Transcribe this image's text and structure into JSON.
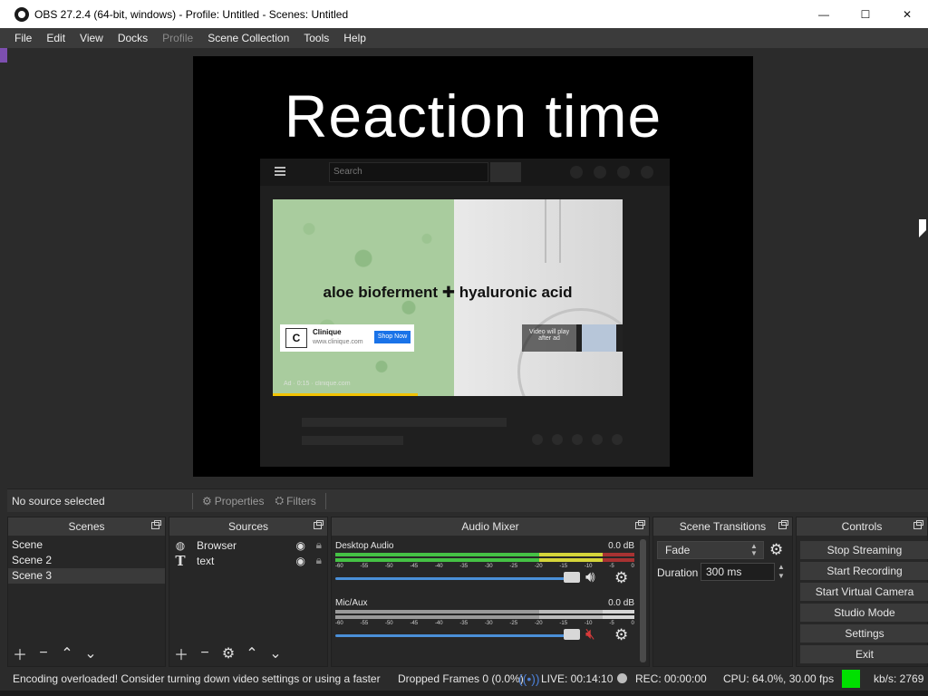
{
  "window": {
    "title": "OBS 27.2.4 (64-bit, windows) - Profile: Untitled - Scenes: Untitled",
    "controls": [
      "—",
      "☐",
      "✕"
    ]
  },
  "menu": {
    "items": [
      "File",
      "Edit",
      "View",
      "Docks",
      "Profile",
      "Scene Collection",
      "Tools",
      "Help"
    ],
    "disabled": [
      "Profile"
    ]
  },
  "preview": {
    "headline": "Reaction time",
    "browser": {
      "search_placeholder": "Search",
      "ad_phrase": "aloe bioferment ✚ hyaluronic acid",
      "ad_brand": "Clinique",
      "ad_brand_logo": "C",
      "ad_url": "www.clinique.com",
      "ad_button": "Shop Now",
      "skip_text": "Video will play after ad",
      "ad_label": "Ad · 0:15 · clinique.com"
    }
  },
  "context": {
    "no_source": "No source selected",
    "properties": "Properties",
    "filters": "Filters"
  },
  "scenes": {
    "title": "Scenes",
    "items": [
      "Scene",
      "Scene 2",
      "Scene 3"
    ],
    "active_index": 2
  },
  "sources": {
    "title": "Sources",
    "items": [
      {
        "name": "Browser",
        "icon": "globe-icon"
      },
      {
        "name": "text",
        "icon": "text-icon"
      }
    ]
  },
  "mixer": {
    "title": "Audio Mixer",
    "scale": [
      "-60",
      "-55",
      "-50",
      "-45",
      "-40",
      "-35",
      "-30",
      "-25",
      "-20",
      "-15",
      "-10",
      "-5",
      "0"
    ],
    "channels": [
      {
        "name": "Desktop Audio",
        "db": "0.0 dB",
        "muted": false,
        "active": true
      },
      {
        "name": "Mic/Aux",
        "db": "0.0 dB",
        "muted": true,
        "active": false
      }
    ]
  },
  "transitions": {
    "title": "Scene Transitions",
    "selected": "Fade",
    "duration_label": "Duration",
    "duration_value": "300 ms"
  },
  "controls": {
    "title": "Controls",
    "buttons": [
      "Stop Streaming",
      "Start Recording",
      "Start Virtual Camera",
      "Studio Mode",
      "Settings",
      "Exit"
    ]
  },
  "status": {
    "warning": "Encoding overloaded! Consider turning down video settings or using a faster",
    "dropped": "Dropped Frames 0 (0.0%)",
    "live": "LIVE: 00:14:10",
    "rec": "REC: 00:00:00",
    "cpu": "CPU: 64.0%, 30.00 fps",
    "kbs": "kb/s: 2769",
    "health_color": "#00e000"
  }
}
